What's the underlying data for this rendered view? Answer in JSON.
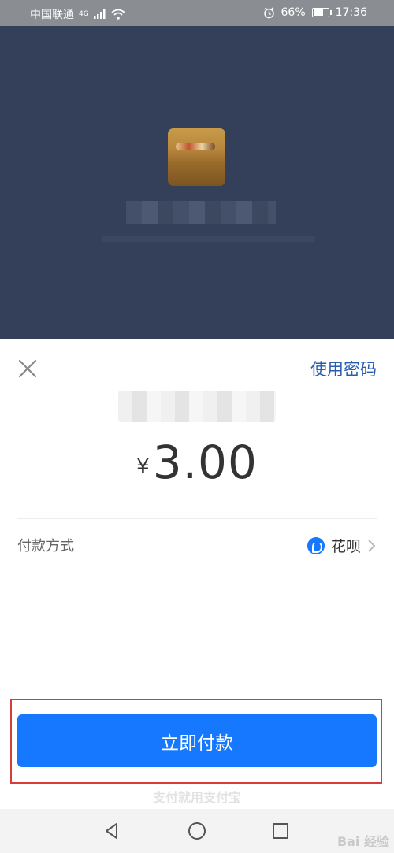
{
  "status_bar": {
    "carrier": "中国联通",
    "network": "4G",
    "battery": "66%",
    "battery_level": 0.66,
    "time": "17:36"
  },
  "sheet": {
    "use_password_label": "使用密码",
    "amount_currency": "¥",
    "amount_value": "3.00",
    "pay_method_label": "付款方式",
    "pay_method_value": "花呗",
    "pay_button_label": "立即付款",
    "footer_slogan": "支付就用支付宝"
  },
  "watermark": "Bai 经验",
  "colors": {
    "accent": "#1677ff",
    "link": "#2a5db0",
    "highlight_border": "#d93a3a",
    "overlay": "#344059"
  },
  "icons": {
    "close": "close-icon",
    "huabei": "huabei-icon",
    "chevron": "chevron-right-icon",
    "back": "back-triangle-icon",
    "home": "home-circle-icon",
    "recents": "recents-square-icon"
  }
}
